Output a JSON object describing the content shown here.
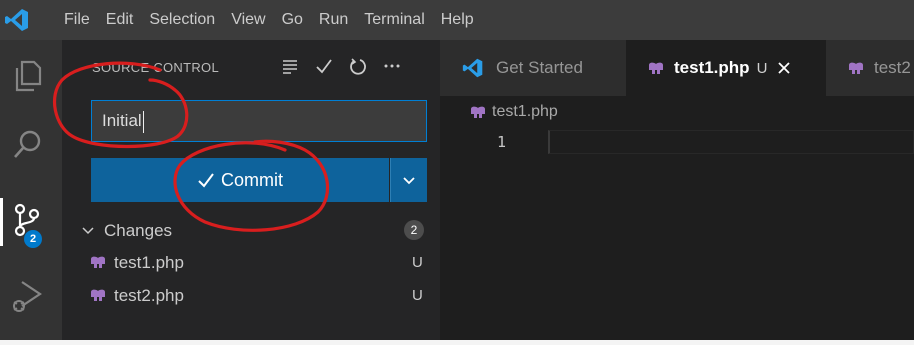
{
  "menu": [
    "File",
    "Edit",
    "Selection",
    "View",
    "Go",
    "Run",
    "Terminal",
    "Help"
  ],
  "activity_bar": {
    "items": [
      "explorer-icon",
      "search-icon",
      "source-control-icon",
      "run-debug-icon"
    ],
    "source_control_badge": "2"
  },
  "source_control": {
    "title": "SOURCE CONTROL",
    "actions": [
      "list-view-icon",
      "check-icon",
      "refresh-icon",
      "more-icon"
    ],
    "message_value": "Initial",
    "commit_label": "Commit",
    "changes_label": "Changes",
    "changes_count": "2",
    "files": [
      {
        "name": "test1.php",
        "status": "U"
      },
      {
        "name": "test2.php",
        "status": "U"
      }
    ]
  },
  "editor": {
    "tabs": [
      {
        "label": "Get Started",
        "active": false
      },
      {
        "label": "test1.php",
        "status": "U",
        "active": true
      },
      {
        "label": "test2",
        "active": false
      }
    ],
    "breadcrumb": "test1.php",
    "line_numbers": [
      "1"
    ]
  },
  "colors": {
    "accent": "#007acc",
    "button": "#0e639c",
    "php_icon": "#a074c4",
    "annotation": "#d81e1e"
  }
}
